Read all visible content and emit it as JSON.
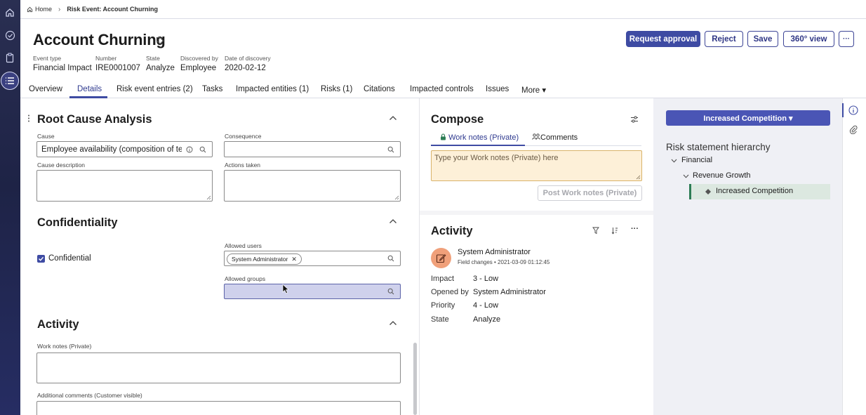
{
  "breadcrumb": {
    "home": "Home",
    "current": "Risk Event: Account Churning"
  },
  "header": {
    "title": "Account Churning",
    "fields": [
      {
        "label": "Event type",
        "value": "Financial Impact"
      },
      {
        "label": "Number",
        "value": "IRE0001007"
      },
      {
        "label": "State",
        "value": "Analyze"
      },
      {
        "label": "Discovered by",
        "value": "Employee"
      },
      {
        "label": "Date of discovery",
        "value": "2020-02-12"
      }
    ],
    "buttons": {
      "request_approval": "Request approval",
      "reject": "Reject",
      "save": "Save",
      "view360": "360° view",
      "more": "···"
    }
  },
  "tabs": [
    "Overview",
    "Details",
    "Risk event entries (2)",
    "Tasks",
    "Impacted entities (1)",
    "Risks (1)",
    "Citations",
    "Impacted controls",
    "Issues",
    "More ▾"
  ],
  "rca": {
    "title": "Root Cause Analysis",
    "cause_label": "Cause",
    "cause_value": "Employee availability (composition of tear",
    "consequence_label": "Consequence",
    "consequence_value": "",
    "cause_desc_label": "Cause description",
    "actions_label": "Actions taken"
  },
  "confidentiality": {
    "title": "Confidentiality",
    "checkbox_label": "Confidential",
    "allowed_users_label": "Allowed users",
    "allowed_user_chip": "System Administrator",
    "allowed_groups_label": "Allowed groups"
  },
  "activity_form": {
    "title": "Activity",
    "work_notes_label": "Work notes (Private)",
    "additional_comments_label": "Additional comments (Customer visible)"
  },
  "compose": {
    "title": "Compose",
    "tab_work_notes": "Work notes (Private)",
    "tab_comments": "Comments",
    "placeholder": "Type your Work notes (Private) here",
    "post_button": "Post Work notes (Private)"
  },
  "activity_stream": {
    "title": "Activity",
    "user": "System Administrator",
    "subtitle": "Field changes • 2021-03-09 01:12:45",
    "changes": [
      {
        "key": "Impact",
        "value": "3 - Low"
      },
      {
        "key": "Opened by",
        "value": "System Administrator"
      },
      {
        "key": "Priority",
        "value": "4 - Low"
      },
      {
        "key": "State",
        "value": "Analyze"
      }
    ]
  },
  "right_panel": {
    "selector": "Increased Competition ▾",
    "hierarchy_title": "Risk statement hierarchy",
    "tree": [
      "Financial",
      "Revenue Growth",
      "Increased Competition"
    ]
  },
  "colors": {
    "accent": "#3e4ba3",
    "rail": "#1e2346",
    "notes_bg": "#fdf0d8",
    "avatar": "#f0a07a",
    "tree_selected": "#2d7d55"
  }
}
